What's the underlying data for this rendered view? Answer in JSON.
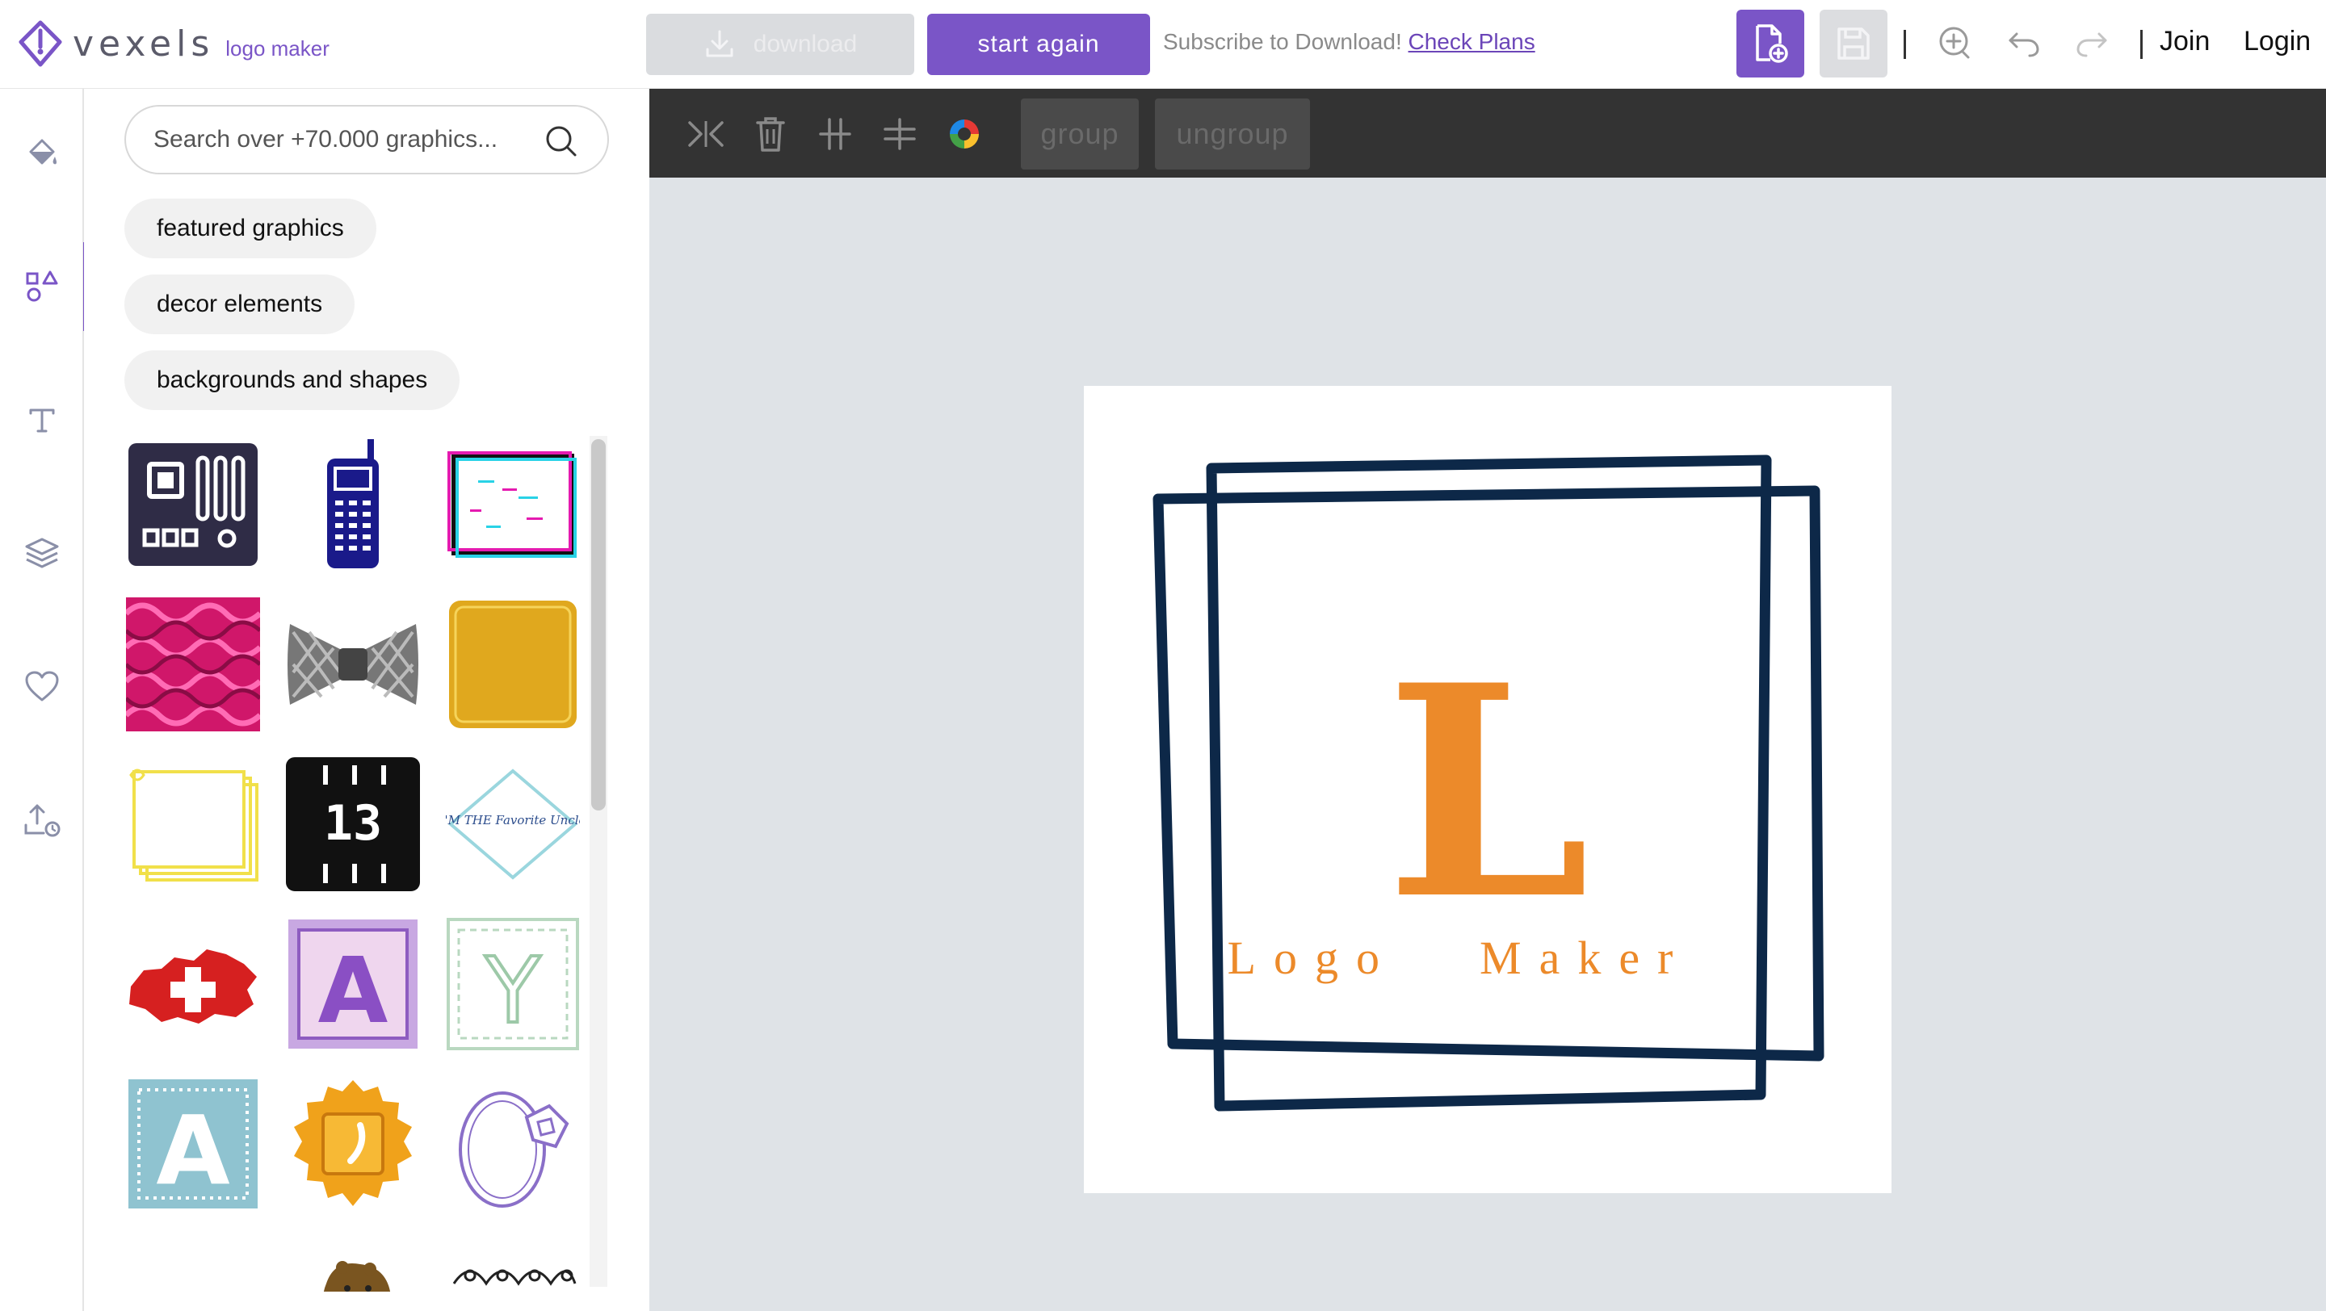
{
  "app": {
    "brand": "vexels",
    "product": "logo maker"
  },
  "topbar": {
    "download_label": "download",
    "start_again_label": "start again",
    "subscribe_text": "Subscribe to Download!",
    "check_plans_label": "Check Plans",
    "join_label": "Join",
    "login_label": "Login"
  },
  "rail": {
    "items": [
      {
        "name": "fill",
        "icon": "paint-bucket-icon"
      },
      {
        "name": "graphics",
        "icon": "shapes-icon",
        "active": true
      },
      {
        "name": "text",
        "icon": "text-icon"
      },
      {
        "name": "layers",
        "icon": "layers-icon"
      },
      {
        "name": "favorites",
        "icon": "heart-icon"
      },
      {
        "name": "upload",
        "icon": "upload-icon"
      }
    ]
  },
  "panel": {
    "search_placeholder": "Search over +70.000 graphics...",
    "chips": [
      "featured graphics",
      "decor elements",
      "backgrounds and shapes"
    ],
    "graphics": [
      {
        "name": "circuit-board",
        "label": ""
      },
      {
        "name": "pixel-phone",
        "label": ""
      },
      {
        "name": "glitch-frame",
        "label": ""
      },
      {
        "name": "pink-pattern",
        "label": ""
      },
      {
        "name": "bow-tie",
        "label": ""
      },
      {
        "name": "gold-square",
        "label": ""
      },
      {
        "name": "yellow-frames",
        "label": ""
      },
      {
        "name": "pixel-13",
        "label": "13"
      },
      {
        "name": "favorite-uncle",
        "label": "I'M THE Favorite Uncle"
      },
      {
        "name": "swiss-map",
        "label": ""
      },
      {
        "name": "letter-a-purple",
        "label": "A"
      },
      {
        "name": "letter-y-green",
        "label": "Y"
      },
      {
        "name": "letter-a-blue",
        "label": "A"
      },
      {
        "name": "gold-seal",
        "label": ""
      },
      {
        "name": "diamond-ring",
        "label": ""
      },
      {
        "name": "beaver",
        "label": ""
      },
      {
        "name": "floral-ornament",
        "label": ""
      }
    ]
  },
  "toolbar": {
    "group_label": "group",
    "ungroup_label": "ungroup"
  },
  "artboard": {
    "letter": "L",
    "tagline_word1": "Logo",
    "tagline_word2": "Maker",
    "colors": {
      "frame": "#0d2848",
      "accent": "#ec8a2a"
    }
  },
  "colors": {
    "brand_purple": "#7a55c7",
    "toolbar_bg": "#333333",
    "canvas_bg": "#dfe3e7"
  }
}
